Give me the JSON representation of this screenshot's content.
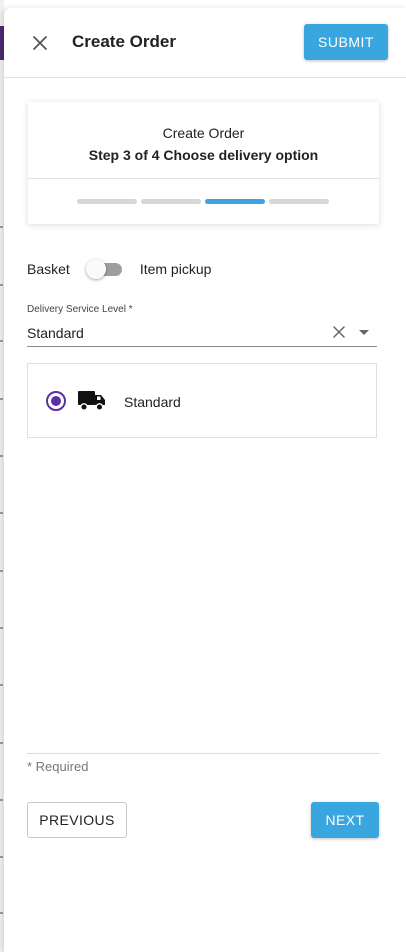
{
  "header": {
    "title": "Create Order",
    "submit_label": "SUBMIT",
    "close_icon": "close-icon"
  },
  "stepper": {
    "title": "Create Order",
    "subtitle": "Step 3 of 4 Choose delivery option",
    "total_steps": 4,
    "current_step": 3
  },
  "fulfillment_toggle": {
    "left_label": "Basket",
    "right_label": "Item pickup",
    "checked": false
  },
  "delivery": {
    "label": "Delivery Service Level *",
    "selected_value": "Standard",
    "options": [
      {
        "label": "Standard",
        "icon": "truck-icon",
        "selected": true
      }
    ]
  },
  "footer": {
    "required_note": "* Required",
    "previous_label": "PREVIOUS",
    "next_label": "NEXT"
  },
  "colors": {
    "primary": "#3aa6e0",
    "radio_accent": "#5b2fa6",
    "inactive_step": "#d7d7d7"
  }
}
